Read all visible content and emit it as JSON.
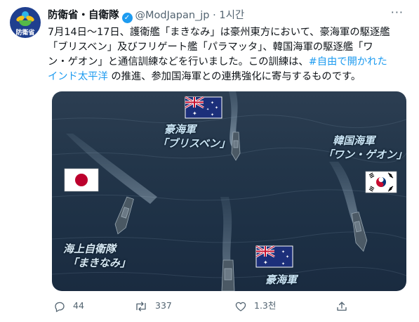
{
  "account": {
    "avatar_text": "防衛省",
    "name": "防衛省・自衛隊",
    "handle": "@ModJapan_jp",
    "separator": "·",
    "time": "1시간",
    "more_label": "···"
  },
  "tweet": {
    "line1": "7月14日～17日、護衛艦「まきなみ」は豪州東方において、豪海軍の駆逐艦",
    "line2": "「ブリスベン」及びフリゲート艦「パラマッタ」、韓国海軍の駆逐艦「ワ",
    "line3_a": "ン・ゲオン」と通信訓練などを行いました。この訓練は、",
    "hashtag_a": "#自由で開かれた",
    "hashtag_b": "インド太平洋",
    "line4_rest": " の推進、参加国海軍との連携強化に寄与するものです。"
  },
  "media": {
    "captions": {
      "aus_top_1": "豪海軍",
      "aus_top_2": "「ブリスベン」",
      "kor_1": "韓国海軍",
      "kor_2": "「ワン・ゲオン」",
      "jp_1": "海上自衛隊",
      "jp_2": "「まきなみ」",
      "aus_bottom_1": "豪海軍"
    },
    "flags": [
      "australia-flag",
      "japan-flag",
      "south-korea-flag",
      "australia-flag"
    ]
  },
  "actions": {
    "reply_count": "44",
    "retweet_count": "337",
    "like_count": "1.3천"
  },
  "colors": {
    "link": "#1d9bf0",
    "secondary_text": "#536471",
    "verified": "#1d9bf0"
  }
}
